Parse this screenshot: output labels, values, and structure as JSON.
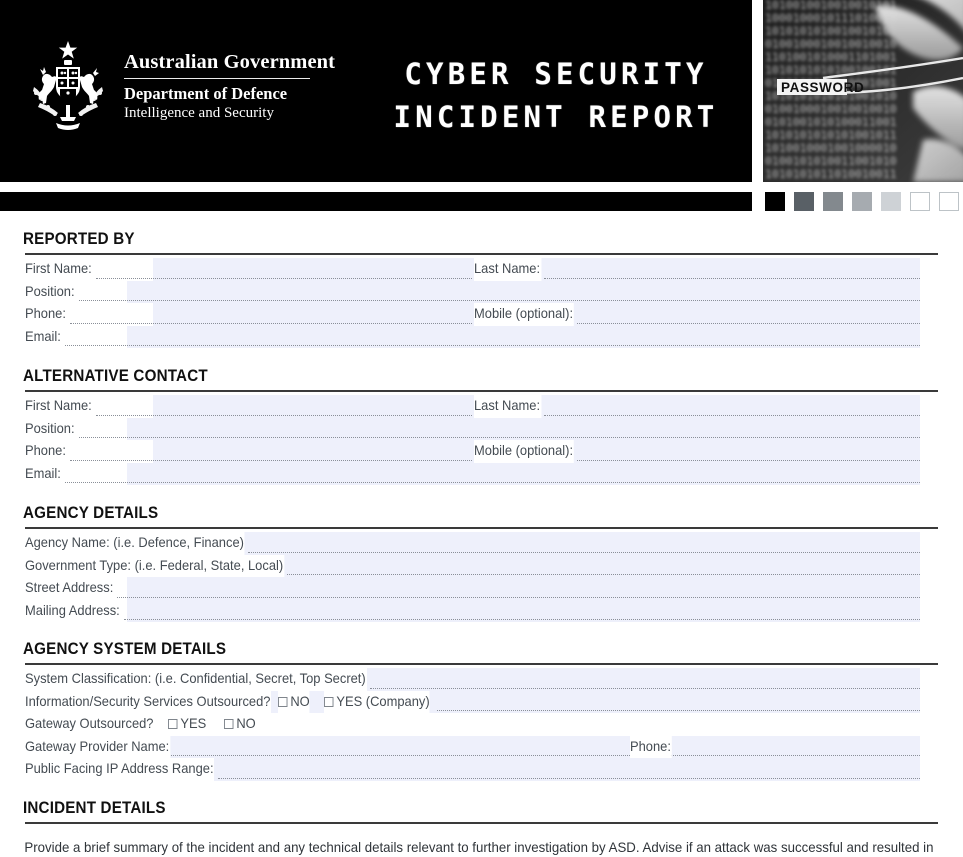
{
  "header": {
    "government_line1": "Australian Government",
    "government_line2": "Department of Defence",
    "government_line3": "Intelligence and Security",
    "title_line1": "CYBER SECURITY",
    "title_line2": "INCIDENT REPORT",
    "crest_icon": "australian-coat-of-arms-icon",
    "photo_caption": "PASSWORD",
    "photo_alt": "binary-code-password-tweezers-photo"
  },
  "swatches": {
    "colors": [
      "#000000",
      "#596066",
      "#83898e",
      "#a6abb0",
      "#ced2d6",
      "#ffffff",
      "#ffffff"
    ]
  },
  "sections": [
    {
      "id": "reported-by",
      "heading": "REPORTED BY",
      "rows": [
        {
          "type": "two",
          "left_label": "First Name:",
          "right_label": "Last Name:"
        },
        {
          "type": "one",
          "left_label": "Position:"
        },
        {
          "type": "two",
          "left_label": "Phone:",
          "right_label": "Mobile (optional):"
        },
        {
          "type": "one",
          "left_label": "Email:"
        }
      ]
    },
    {
      "id": "alternative-contact",
      "heading": "ALTERNATIVE CONTACT",
      "rows": [
        {
          "type": "two",
          "left_label": "First Name:",
          "right_label": "Last Name:"
        },
        {
          "type": "one",
          "left_label": "Position:"
        },
        {
          "type": "two",
          "left_label": "Phone:",
          "right_label": "Mobile (optional):"
        },
        {
          "type": "one",
          "left_label": "Email:"
        }
      ]
    },
    {
      "id": "agency-details",
      "heading": "AGENCY DETAILS",
      "rows": [
        {
          "type": "one",
          "left_label": "Agency Name: (i.e. Defence, Finance)"
        },
        {
          "type": "one",
          "left_label": "Government Type: (i.e. Federal, State, Local)"
        },
        {
          "type": "one",
          "left_label": "Street Address:"
        },
        {
          "type": "one",
          "left_label": "Mailing Address:"
        }
      ]
    },
    {
      "id": "agency-system-details",
      "heading": "AGENCY SYSTEM DETAILS",
      "rows": [
        {
          "type": "one",
          "left_label": "System Classification: (i.e. Confidential, Secret, Top Secret)"
        },
        {
          "type": "checkbox-line",
          "left_label": "Information/Security Services Outsourced?",
          "options": [
            "NO",
            "YES (Company)"
          ]
        },
        {
          "type": "checkbox-only",
          "left_label": "Gateway Outsourced?",
          "options": [
            "YES",
            "NO"
          ]
        },
        {
          "type": "two",
          "left_label": "Gateway Provider Name:",
          "right_label": "Phone:"
        },
        {
          "type": "one",
          "left_label": "Public Facing IP Address Range:"
        }
      ]
    },
    {
      "id": "incident-details",
      "heading": "INCIDENT DETAILS",
      "paragraph": "Provide a brief summary of the incident and any technical details relevant to further investigation by ASD. Advise if an attack was successful and resulted in"
    }
  ]
}
